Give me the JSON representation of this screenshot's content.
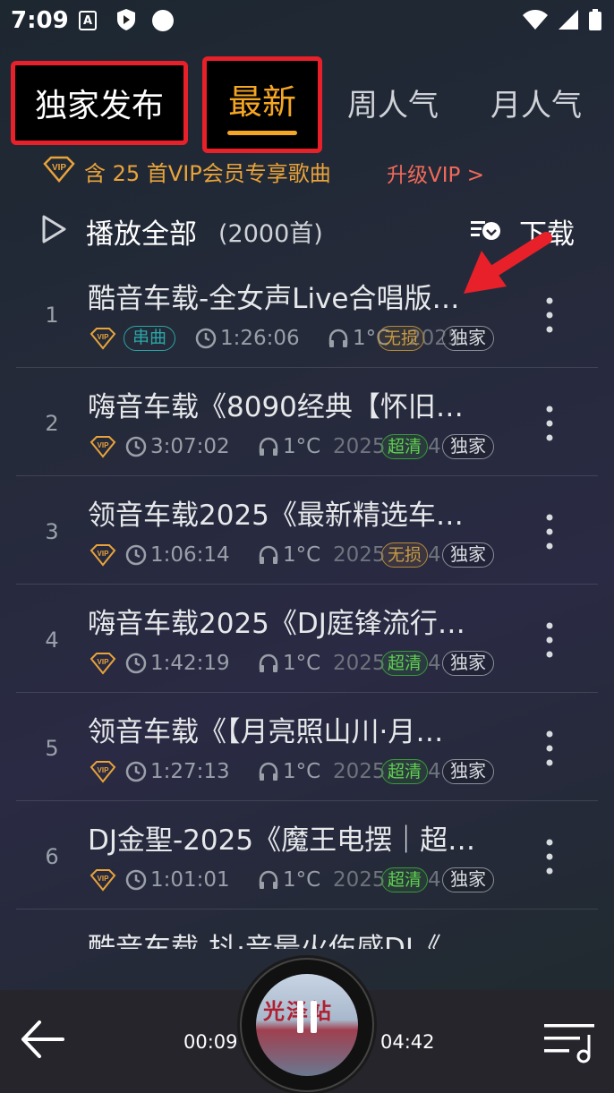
{
  "status_bar": {
    "time": "7:09",
    "a_icon_label": "A"
  },
  "tabs": {
    "exclusive": "独家发布",
    "latest": "最新",
    "week": "周人气",
    "month": "月人气"
  },
  "vip_banner": {
    "text": "含 25 首VIP会员专享歌曲",
    "upgrade": "升级VIP >"
  },
  "play_all": {
    "label": "播放全部",
    "count": "(2000首)",
    "download": "下载"
  },
  "songs": [
    {
      "index": "1",
      "title": "酷音车载-全女声Live合唱版…",
      "tag": "串曲",
      "duration": "1:26:06",
      "temp": "1°C",
      "year": "2025",
      "quality": "无损",
      "exclusive": "独家"
    },
    {
      "index": "2",
      "title": "嗨音车载《8090经典【怀旧…",
      "duration": "3:07:02",
      "temp": "1°C",
      "year": "2025",
      "quality": "超清",
      "suffix": "4",
      "exclusive": "独家"
    },
    {
      "index": "3",
      "title": "领音车载2025《最新精选车…",
      "duration": "1:06:14",
      "temp": "1°C",
      "year": "2025",
      "quality": "无损",
      "suffix": "4",
      "exclusive": "独家"
    },
    {
      "index": "4",
      "title": "嗨音车载2025《DJ庭锋流行…",
      "duration": "1:42:19",
      "temp": "1°C",
      "year": "2025",
      "quality": "超清",
      "suffix": "4",
      "exclusive": "独家"
    },
    {
      "index": "5",
      "title": "领音车载《【月亮照山川·月…",
      "duration": "1:27:13",
      "temp": "1°C",
      "year": "2025",
      "quality": "超清",
      "suffix": "4",
      "exclusive": "独家"
    },
    {
      "index": "6",
      "title": "DJ金聖-2025《魔王电摆｜超…",
      "duration": "1:01:01",
      "temp": "1°C",
      "year": "2025",
      "quality": "超清",
      "suffix": "4",
      "exclusive": "独家"
    },
    {
      "index": "",
      "title": "酷音车载-抖·音最火伤感DJ《"
    }
  ],
  "player": {
    "position": "00:09",
    "duration": "04:42",
    "cover_text": "光泽站"
  },
  "colors": {
    "accent": "#f5a623",
    "annotation_red": "#e8202a",
    "vip_gold": "#e8a33a",
    "upgrade_red": "#f06a5a"
  }
}
